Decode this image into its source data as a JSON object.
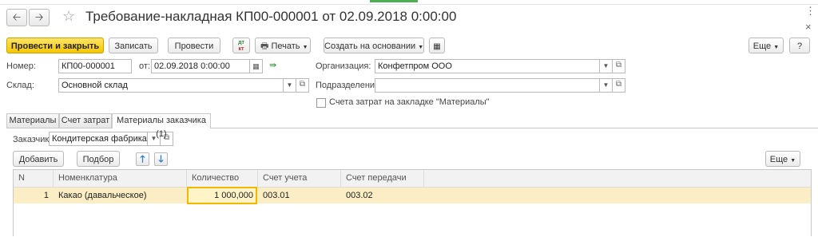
{
  "window": {
    "title": "Требование-накладная КП00-000001 от 02.09.2018 0:00:00",
    "menu_glyph": "⋮",
    "close_glyph": "×"
  },
  "toolbar": {
    "post_close": "Провести и закрыть",
    "save": "Записать",
    "post": "Провести",
    "dt_kt_top": "дт",
    "dt_kt_bottom": "кт",
    "print": "Печать",
    "create_based": "Создать на основании",
    "more": "Еще",
    "help": "?"
  },
  "form": {
    "number_label": "Номер:",
    "number_value": "КП00-000001",
    "date_label": "от:",
    "date_value": "02.09.2018  0:00:00",
    "org_label": "Организация:",
    "org_value": "Конфетпром ООО",
    "warehouse_label": "Склад:",
    "warehouse_value": "Основной склад",
    "dept_label": "Подразделение:",
    "dept_value": "",
    "checkbox_label": "Счета затрат на закладке \"Материалы\""
  },
  "tabs": [
    {
      "label": "Материалы"
    },
    {
      "label": "Счет затрат"
    },
    {
      "label": "Материалы заказчика (1)"
    }
  ],
  "customer": {
    "label": "Заказчик:",
    "value": "Кондитерская фабрика куп"
  },
  "table_toolbar": {
    "add": "Добавить",
    "select": "Подбор",
    "more": "Еще"
  },
  "table": {
    "columns": [
      "N",
      "Номенклатура",
      "Количество",
      "Счет учета",
      "Счет передачи"
    ],
    "rows": [
      {
        "n": "1",
        "item": "Какао (давальческое)",
        "qty": "1 000,000",
        "account": "003.01",
        "transfer_account": "003.02"
      }
    ]
  },
  "colors": {
    "primary_button": "#f4c600",
    "selected_row": "#fbeec4",
    "active_cell_border": "#f0b800"
  }
}
